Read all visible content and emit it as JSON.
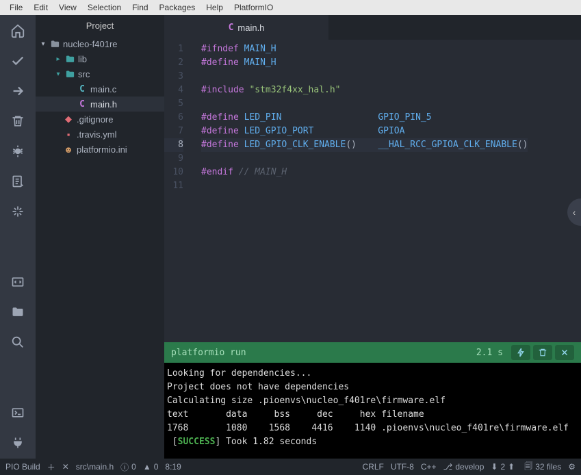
{
  "menu": [
    "File",
    "Edit",
    "View",
    "Selection",
    "Find",
    "Packages",
    "Help",
    "PlatformIO"
  ],
  "sidebar_title": "Project",
  "tree": {
    "root": "nucleo-f401re",
    "lib": "lib",
    "src": "src",
    "main_c": "main.c",
    "main_h": "main.h",
    "gitignore": ".gitignore",
    "travis": ".travis.yml",
    "pio": "platformio.ini"
  },
  "tab": {
    "label": "main.h"
  },
  "code_lines": [
    {
      "n": 1,
      "html": "<span class='kw'>#ifndef</span> <span class='ident'>MAIN_H</span>"
    },
    {
      "n": 2,
      "html": "<span class='kw'>#define</span> <span class='ident'>MAIN_H</span>"
    },
    {
      "n": 3,
      "html": ""
    },
    {
      "n": 4,
      "html": "<span class='kw'>#include</span> <span class='str'>\"stm32f4xx_hal.h\"</span>"
    },
    {
      "n": 5,
      "html": ""
    },
    {
      "n": 6,
      "html": "<span class='kw'>#define</span> <span class='ident'>LED_PIN</span>                  <span class='ident'>GPIO_PIN_5</span>"
    },
    {
      "n": 7,
      "html": "<span class='kw'>#define</span> <span class='ident'>LED_GPIO_PORT</span>            <span class='ident'>GPIOA</span>"
    },
    {
      "n": 8,
      "html": "<span class='kw'>#define</span> <span class='fn'>LED_GPIO_CLK_ENABLE</span>()    <span class='fn'>__HAL_RCC_GPIOA_CLK_ENABLE</span>()",
      "hl": true
    },
    {
      "n": 9,
      "html": ""
    },
    {
      "n": 10,
      "html": "<span class='kw'>#endif</span> <span class='com'>// MAIN_H</span>"
    },
    {
      "n": 11,
      "html": ""
    }
  ],
  "terminal": {
    "cmd": "platformio run",
    "elapsed": "2.1 s",
    "lines": [
      "Looking for dependencies...",
      "Project does not have dependencies",
      "Calculating size .pioenvs\\nucleo_f401re\\firmware.elf",
      "text       data     bss     dec     hex filename",
      "1768       1080    1568    4416    1140 .pioenvs\\nucleo_f401re\\firmware.elf"
    ],
    "success_prefix": " [",
    "success": "SUCCESS",
    "success_suffix": "] Took 1.82 seconds"
  },
  "status": {
    "pio_build": "PIO Build",
    "path": "src\\main.h",
    "diag_info": "0",
    "diag_warn": "0",
    "cursor": "8:19",
    "crlf": "CRLF",
    "encoding": "UTF-8",
    "lang": "C++",
    "branch": "develop",
    "down": "2",
    "up": "",
    "files": "32 files"
  }
}
